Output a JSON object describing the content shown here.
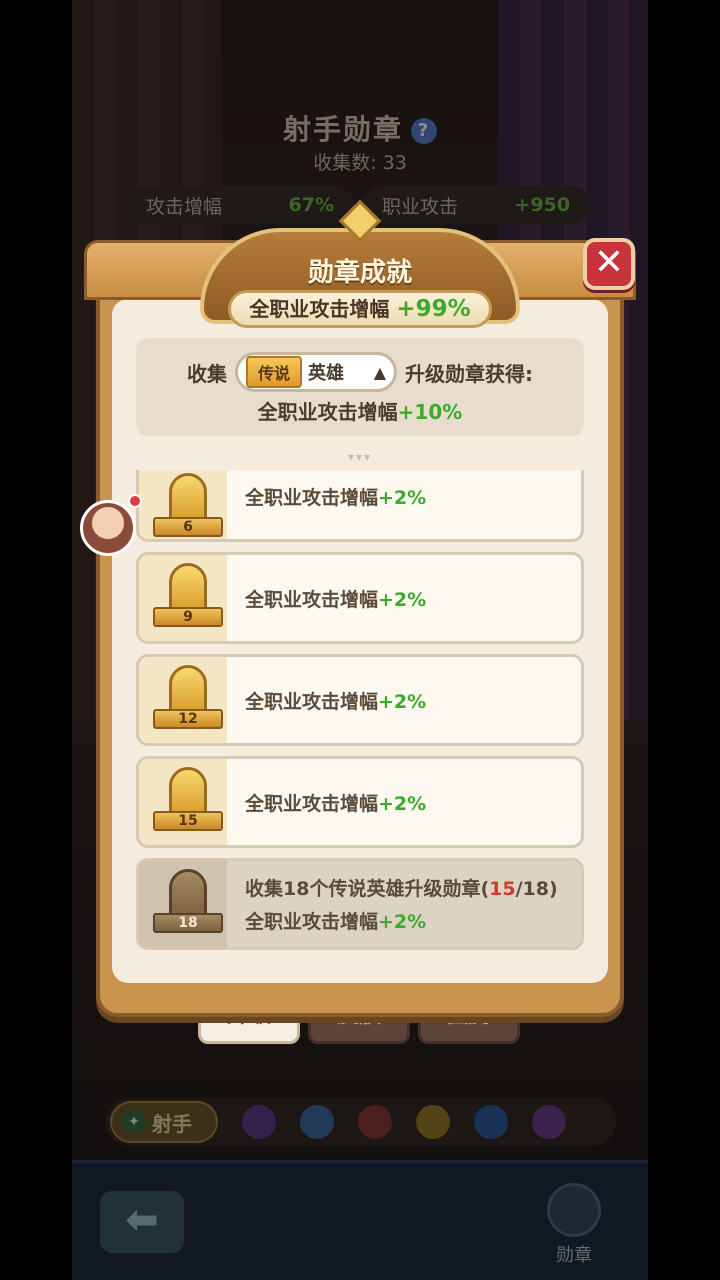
{
  "background": {
    "title": "射手勋章",
    "help_icon": "question-icon",
    "collect_count": "收集数: 33",
    "stats": [
      {
        "label": "攻击增幅",
        "value": "67%"
      },
      {
        "label": "职业攻击",
        "value": "+950"
      }
    ],
    "tabs": [
      {
        "label": "升级",
        "active": true
      },
      {
        "label": "皮肤",
        "active": false
      },
      {
        "label": "图腾",
        "active": false
      }
    ],
    "class_selected": "射手",
    "class_icons": [
      "wand-icon",
      "swirl-icon",
      "sword-icon",
      "bird-icon",
      "paw-icon",
      "eye-icon"
    ],
    "back_icon": "back-arrow-icon",
    "nav_medal_label": "勋章"
  },
  "popup": {
    "title": "勋章成就",
    "total_label": "全职业攻击增幅",
    "total_value": "+99%",
    "close_icon": "close-icon",
    "collect_label": "收集",
    "selector_tag": "传说",
    "selector_value": "英雄",
    "selector_arrow": "▲",
    "upgrade_label": "升级勋章获得:",
    "reward_label": "全职业攻击增幅",
    "reward_value": "+10%"
  },
  "achievements": [
    {
      "level": "6",
      "text": "全职业攻击增幅",
      "value": "+2%",
      "locked": false
    },
    {
      "level": "9",
      "text": "全职业攻击增幅",
      "value": "+2%",
      "locked": false
    },
    {
      "level": "12",
      "text": "全职业攻击增幅",
      "value": "+2%",
      "locked": false
    },
    {
      "level": "15",
      "text": "全职业攻击增幅",
      "value": "+2%",
      "locked": false
    },
    {
      "level": "18",
      "requirement": "收集18个传说英雄升级勋章(",
      "progress_current": "15",
      "progress_total": "/18)",
      "text": "全职业攻击增幅",
      "value": "+2%",
      "locked": true
    }
  ],
  "colors": {
    "accent_green": "#3daa2e",
    "progress_red": "#d23b2c",
    "close_red": "#c9333c",
    "gold": "#d99d2c"
  }
}
